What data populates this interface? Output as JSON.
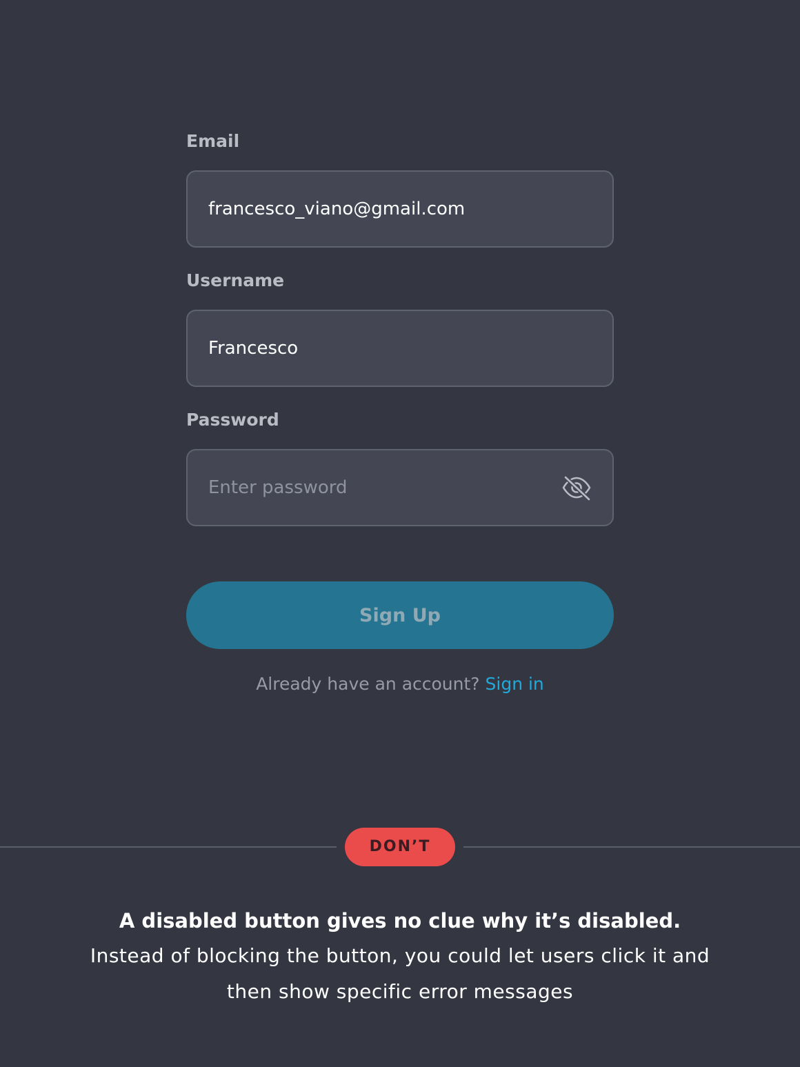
{
  "form": {
    "email": {
      "label": "Email",
      "value": "francesco_viano@gmail.com",
      "placeholder": ""
    },
    "username": {
      "label": "Username",
      "value": "Francesco",
      "placeholder": ""
    },
    "password": {
      "label": "Password",
      "value": "",
      "placeholder": "Enter password",
      "toggle_icon": "eye-off-icon"
    },
    "submit": {
      "label": "Sign Up",
      "disabled": true
    },
    "signin_prompt": {
      "text": "Already have an account?",
      "link_label": "Sign in"
    }
  },
  "verdict": {
    "badge": "DON’T"
  },
  "caption": {
    "title": "A disabled button gives no clue why it’s disabled.",
    "body": "Instead of blocking the button, you could let users click it and then show specific error messages"
  },
  "colors": {
    "background": "#343741",
    "field_background": "#444753",
    "field_border": "#5f6370",
    "button_disabled": "#257592",
    "link": "#22a9dc",
    "badge": "#ea4b4b"
  }
}
